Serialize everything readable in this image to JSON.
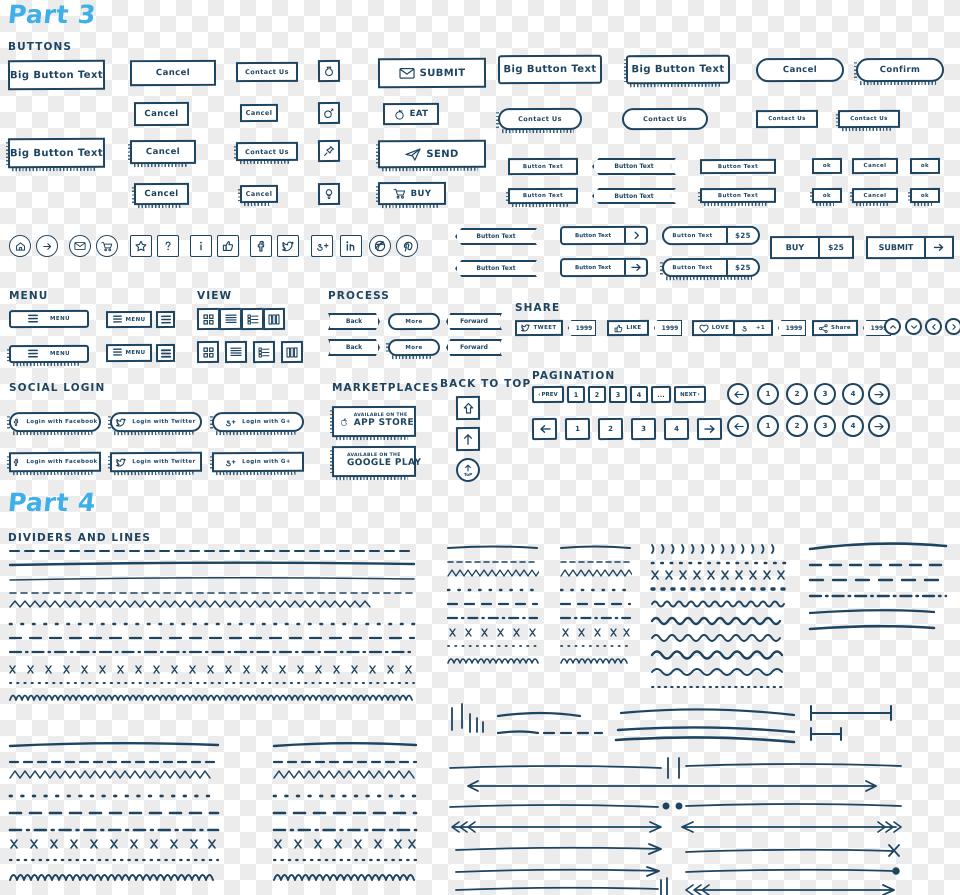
{
  "meta": {
    "stroke_color": "#1d4461",
    "accent_color": "#3FAFE8",
    "background": "transparent-checkerboard"
  },
  "part3": {
    "title": "Part 3",
    "sections": {
      "buttons": "BUTTONS",
      "menu": "MENU",
      "view": "VIEW",
      "process": "PROCESS",
      "share": "SHARE",
      "social_login": "SOCIAL LOGIN",
      "marketplaces": "MARKETPLACES",
      "back_to_top": "BACK TO TOP",
      "pagination": "PAGINATION"
    },
    "labels": {
      "big_button_text": "Big Button Text",
      "cancel": "Cancel",
      "confirm": "Confirm",
      "contact_us": "Contact Us",
      "submit": "SUBMIT",
      "eat": "EAT",
      "send": "SEND",
      "buy": "BUY",
      "button_text": "Button Text",
      "ok": "ok",
      "price": "$25",
      "menu": "MENU",
      "back": "Back",
      "more": "More",
      "forward": "Forward",
      "tweet": "TWEET",
      "like": "LIKE",
      "love": "LOVE",
      "gplus_one": "+1",
      "share": "Share",
      "count": "1999",
      "login_facebook": "Login with Facebook",
      "login_twitter": "Login with Twitter",
      "login_gplus": "Login with G+",
      "available_on_the": "AVAILABLE ON THE",
      "app_store": "APP STORE",
      "google_play": "GOOGLE PLAY",
      "top": "ToP",
      "prev": "PREV",
      "next": "NEXT",
      "ellipsis": "...",
      "page_1": "1",
      "page_2": "2",
      "page_3": "3",
      "page_4": "4"
    },
    "icons": {
      "row": [
        "home-icon",
        "arrow-right-circle-icon",
        "envelope-icon",
        "cart-icon",
        "star-icon",
        "question-icon",
        "info-icon",
        "thumbs-up-icon",
        "facebook-icon",
        "twitter-icon",
        "google-plus-icon",
        "linkedin-icon",
        "dribbble-icon",
        "pinterest-icon"
      ],
      "button_icons": [
        "money-bag-icon",
        "ring-icon",
        "pin-icon",
        "bulb-icon"
      ],
      "action_icons": [
        "envelope-icon",
        "apple-icon",
        "paper-plane-icon",
        "cart-icon"
      ],
      "nav_circles": [
        "chevron-up-icon",
        "chevron-down-icon",
        "chevron-left-icon",
        "chevron-right-icon"
      ]
    }
  },
  "part4": {
    "title": "Part 4",
    "sections": {
      "dividers": "DIVIDERS AND LINES"
    },
    "divider_styles": [
      "dashed-long",
      "solid-brush",
      "solid-thin",
      "dashed-short",
      "zigzag",
      "dots-sparse",
      "dash-medium",
      "dash-dot",
      "x-marks",
      "dots-dense",
      "loops"
    ],
    "arrow_styles": [
      "tick-marks",
      "brush-lines",
      "stacked-lines",
      "measure-bar",
      "line-break",
      "double-arrow",
      "dot-divider",
      "feather-arrow",
      "arrow-right",
      "arrow-x-end",
      "arrow-dot-end",
      "arrow-bar-end"
    ]
  }
}
